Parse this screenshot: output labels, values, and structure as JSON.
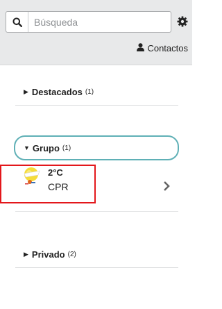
{
  "search": {
    "placeholder": "Búsqueda"
  },
  "header": {
    "contacts_label": "Contactos"
  },
  "sections": {
    "destacados": {
      "label": "Destacados",
      "count": "(1)"
    },
    "grupo": {
      "label": "Grupo",
      "count": "(1)"
    },
    "privado": {
      "label": "Privado",
      "count": "(2)"
    }
  },
  "contact": {
    "temperature": "2°C",
    "name": "CPR"
  },
  "colors": {
    "highlight": "#e3171b",
    "group_outline": "#5fb0b6",
    "header_bg": "#e8e9ea"
  },
  "icons": [
    "search-icon",
    "gear-icon",
    "user-icon",
    "caret-right-icon",
    "caret-down-icon",
    "weather-avatar-icon",
    "chevron-right-icon"
  ]
}
